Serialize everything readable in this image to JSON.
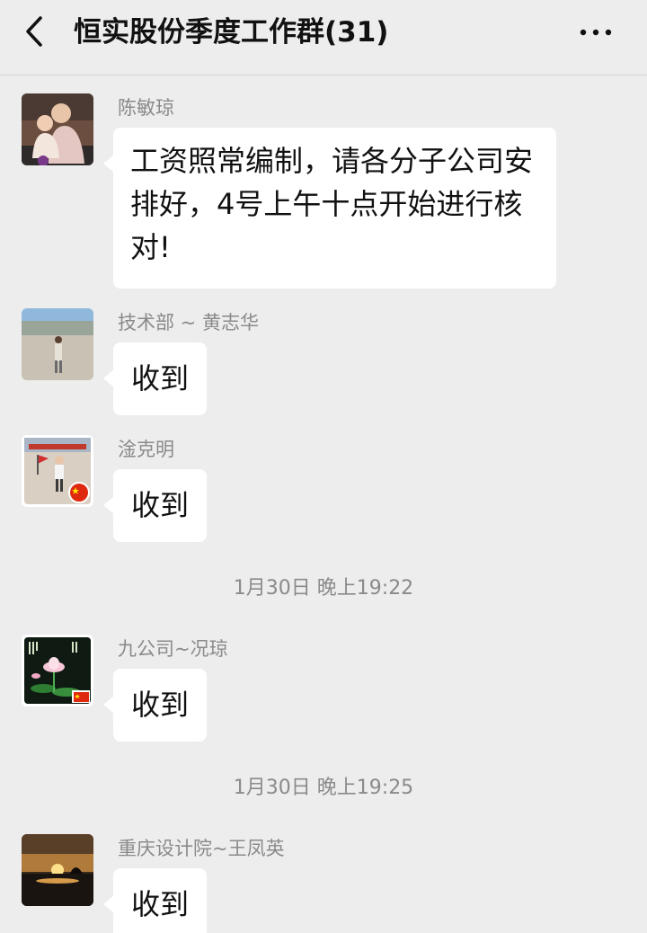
{
  "header": {
    "title": "恒实股份季度工作群(31)",
    "back_icon": "chevron-left-icon",
    "more_icon": "more-dots-icon"
  },
  "messages": [
    {
      "sender": "陈敏琼",
      "text": "工资照常编制，请各分子公司安排好，4号上午十点开始进行核对!",
      "avatar": "avatar-children-photo"
    },
    {
      "sender": "技术部 ~ 黄志华",
      "text": "收到",
      "avatar": "avatar-outdoor-square-photo"
    },
    {
      "sender": "淦克明",
      "text": "收到",
      "avatar": "avatar-child-with-flag-photo"
    },
    {
      "sender": "九公司~况琼",
      "text": "收到",
      "avatar": "avatar-lotus-photo"
    },
    {
      "sender": "重庆设计院~王凤英",
      "text": "收到",
      "avatar": "avatar-sunset-photo"
    }
  ],
  "timestamps": [
    "1月30日 晚上19:22",
    "1月30日 晚上19:25"
  ],
  "colors": {
    "background": "#ededed",
    "bubble": "#ffffff",
    "secondary_text": "#8a8a8a",
    "primary_text": "#111111"
  }
}
